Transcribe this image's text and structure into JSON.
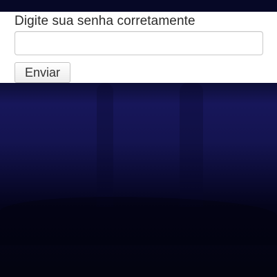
{
  "form": {
    "prompt_label": "Digite sua senha corretamente",
    "password_value": "",
    "submit_label": "Enviar"
  },
  "colors": {
    "panel_background": "#ffffff",
    "page_background_dark": "#060826",
    "page_background_mid": "#17165a"
  }
}
